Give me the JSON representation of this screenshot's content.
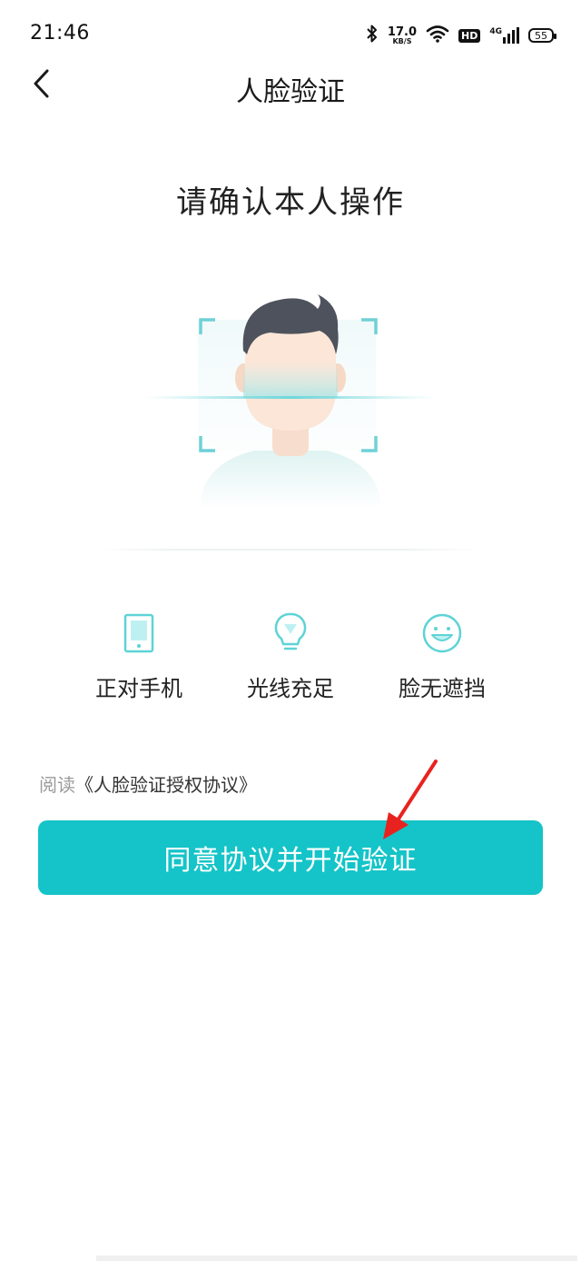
{
  "status_bar": {
    "time": "21:46",
    "net_speed": "17.0",
    "net_unit": "KB/S",
    "hd": "HD",
    "network": "4G",
    "battery": "55"
  },
  "nav": {
    "title": "人脸验证"
  },
  "main": {
    "prompt": "请确认本人操作",
    "tips": [
      {
        "label": "正对手机",
        "icon": "phone-icon"
      },
      {
        "label": "光线充足",
        "icon": "light-bulb-icon"
      },
      {
        "label": "脸无遮挡",
        "icon": "smile-face-icon"
      }
    ],
    "agreement": {
      "prefix": "阅读",
      "link": "《人脸验证授权协议》"
    },
    "start_button": "同意协议并开始验证"
  },
  "colors": {
    "accent": "#14c4c8",
    "icon": "#5ed3d6",
    "annotation": "#e8231f"
  }
}
